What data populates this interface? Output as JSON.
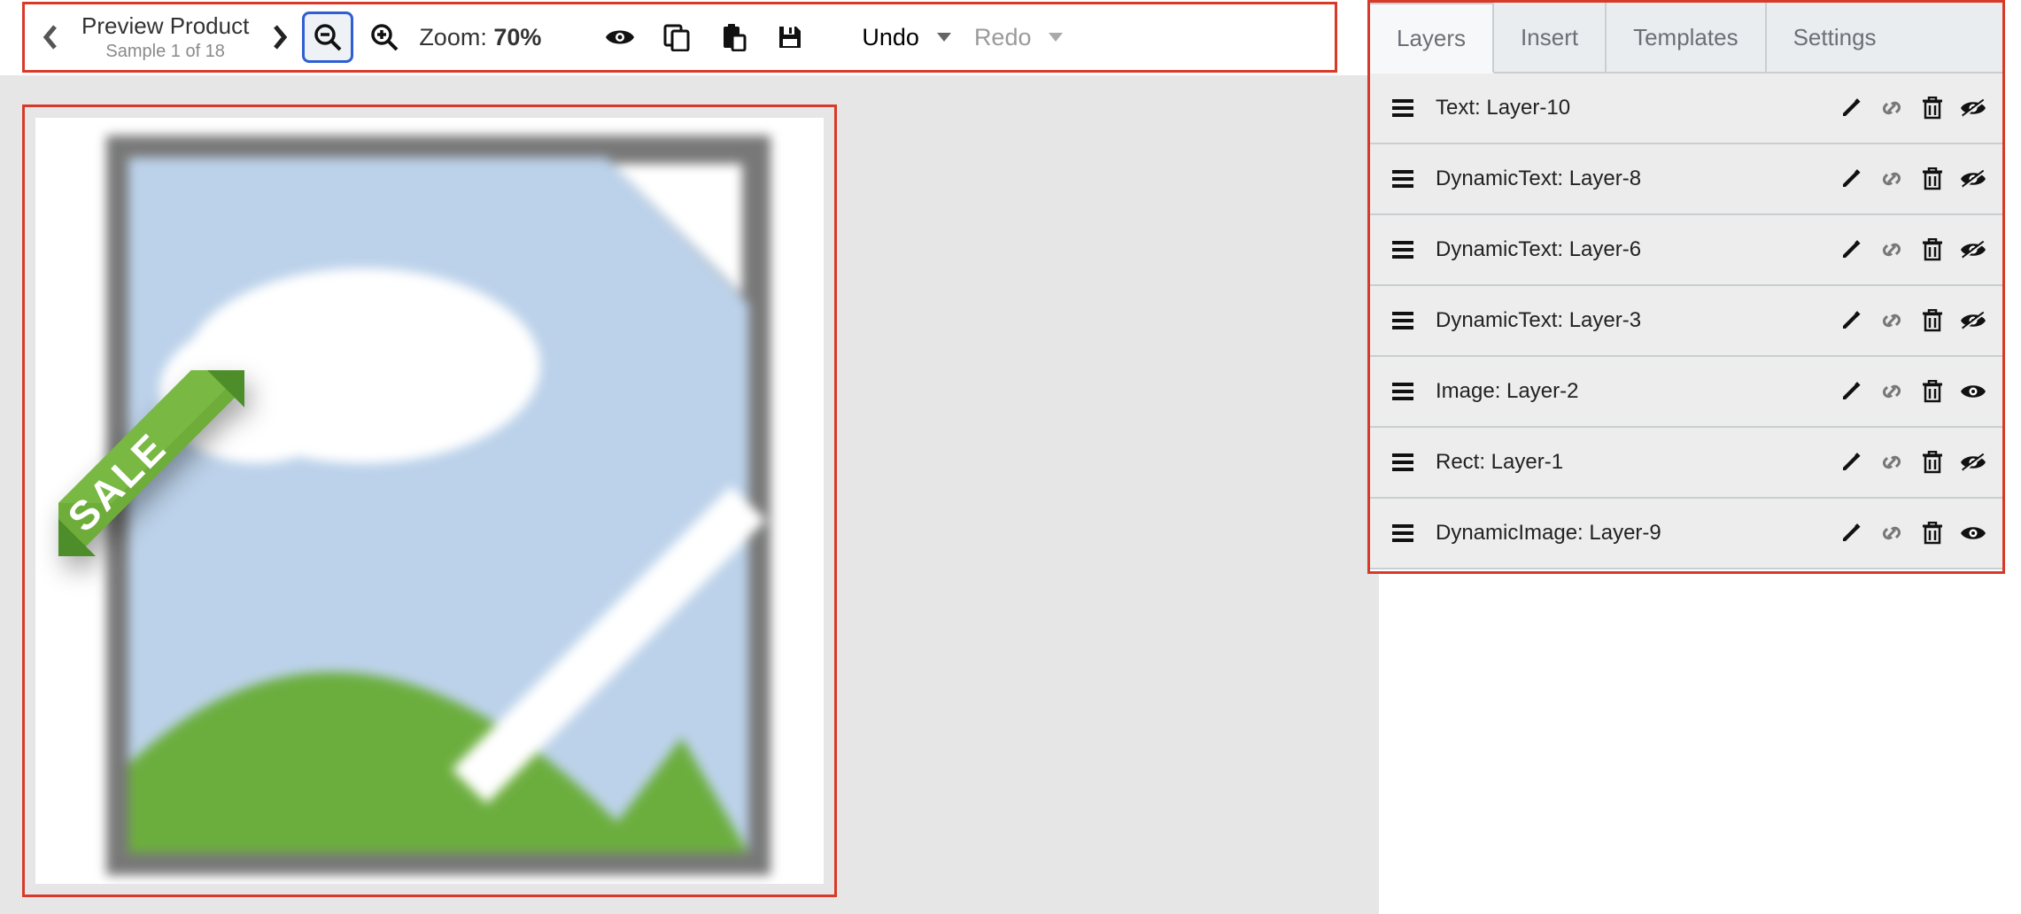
{
  "toolbar": {
    "preview_title": "Preview Product",
    "preview_sub": "Sample 1 of 18",
    "zoom_label_prefix": "Zoom: ",
    "zoom_value": "70%",
    "undo_label": "Undo",
    "redo_label": "Redo"
  },
  "canvas": {
    "ribbon_text": "SALE"
  },
  "panel": {
    "tabs": [
      {
        "label": "Layers",
        "active": true
      },
      {
        "label": "Insert",
        "active": false
      },
      {
        "label": "Templates",
        "active": false
      },
      {
        "label": "Settings",
        "active": false
      }
    ],
    "layers": [
      {
        "label": "Text: Layer-10",
        "visible": false
      },
      {
        "label": "DynamicText: Layer-8",
        "visible": false
      },
      {
        "label": "DynamicText: Layer-6",
        "visible": false
      },
      {
        "label": "DynamicText: Layer-3",
        "visible": false
      },
      {
        "label": "Image: Layer-2",
        "visible": true
      },
      {
        "label": "Rect: Layer-1",
        "visible": false
      },
      {
        "label": "DynamicImage: Layer-9",
        "visible": true
      }
    ]
  }
}
